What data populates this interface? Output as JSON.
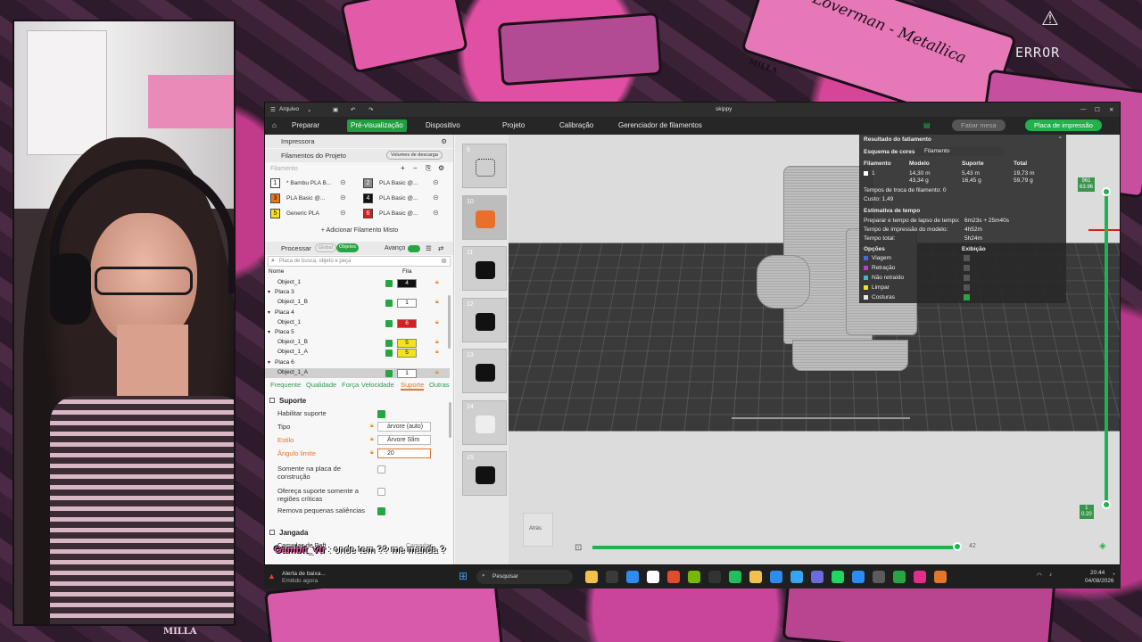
{
  "background": {
    "tape_labels": [
      "Loverman - Metallica",
      "MILLA",
      "MILLA"
    ],
    "error_text": "ERROR"
  },
  "window": {
    "title": "skippy",
    "menu_label": "Arquivo"
  },
  "navbar": {
    "items": [
      "Preparar",
      "Pré-visualização",
      "Dispositivo",
      "Projeto",
      "Calibração",
      "Gerenciador de filamentos"
    ],
    "active_index": 1,
    "fatiar_label": "Fatiar mesa",
    "print_label": "Placa de impressão"
  },
  "left_panel": {
    "printer_label": "Impressora",
    "filaments_label": "Filamentos do Projeto",
    "volumes_label": "Volumes de descarga",
    "filament_header": "Filamento",
    "filaments": [
      {
        "num": "1",
        "name": "* Bambu PLA B...",
        "color": "#ffffff",
        "text_color": "#111111"
      },
      {
        "num": "2",
        "name": "PLA Basic @...",
        "color": "#8a8a8a",
        "text_color": "#ffffff"
      },
      {
        "num": "3",
        "name": "PLA Basic @...",
        "color": "#e87722",
        "text_color": "#111111"
      },
      {
        "num": "4",
        "name": "PLA Basic @...",
        "color": "#111111",
        "text_color": "#ffffff"
      },
      {
        "num": "5",
        "name": "Generic PLA",
        "color": "#f5e21a",
        "text_color": "#111111"
      },
      {
        "num": "6",
        "name": "PLA Basic @...",
        "color": "#d42020",
        "text_color": "#ffffff"
      }
    ],
    "add_mixed": "+ Adicionar Filamento Misto",
    "process_label": "Processar",
    "global_label": "Global",
    "objects_label": "Objetos",
    "advanced_label": "Avanço",
    "search_placeholder": "Placa de busca, objeto e peça",
    "col_name": "Nome",
    "col_fil": "Fila",
    "objects": [
      {
        "label": "Object_1",
        "indent": 1,
        "fil": "4",
        "fil_color": "#111111",
        "fil_text": "#ffffff",
        "check": true
      },
      {
        "label": "Placa 3",
        "indent": 0,
        "fil": "",
        "check": false
      },
      {
        "label": "Object_1_B",
        "indent": 1,
        "fil": "1",
        "fil_color": "#ffffff",
        "fil_text": "#111111",
        "check": true
      },
      {
        "label": "Placa 4",
        "indent": 0,
        "fil": "",
        "check": false
      },
      {
        "label": "Object_1",
        "indent": 1,
        "fil": "6",
        "fil_color": "#d42020",
        "fil_text": "#ffffff",
        "check": true
      },
      {
        "label": "Placa 5",
        "indent": 0,
        "fil": "",
        "check": false
      },
      {
        "label": "Object_1_B",
        "indent": 1,
        "fil": "5",
        "fil_color": "#f5e21a",
        "fil_text": "#111111",
        "check": true
      },
      {
        "label": "Object_1_A",
        "indent": 1,
        "fil": "5",
        "fil_color": "#f5e21a",
        "fil_text": "#111111",
        "check": true
      },
      {
        "label": "Placa 6",
        "indent": 0,
        "fil": "",
        "check": false
      },
      {
        "label": "Object_1_A",
        "indent": 1,
        "fil": "1",
        "fil_color": "#ffffff",
        "fil_text": "#111111",
        "check": true,
        "selected": true
      }
    ],
    "tabs": [
      "Frequente",
      "Qualidade",
      "Força",
      "Velocidade",
      "Suporte",
      "Outras"
    ],
    "active_tab": 4,
    "support_title": "Suporte",
    "settings": [
      {
        "label": "Habilitar suporte",
        "type": "check",
        "on": true,
        "red": false
      },
      {
        "label": "Tipo",
        "type": "select",
        "value": "árvore (auto)",
        "red": false
      },
      {
        "label": "Estilo",
        "type": "select",
        "value": "Árvore Slim",
        "red": true
      },
      {
        "label": "Ângulo limite",
        "type": "input",
        "value": "20",
        "red": true
      },
      {
        "label": "Somente na placa de construção",
        "type": "check",
        "on": false,
        "red": false
      },
      {
        "label": "Ofereça suporte somente a regiões críticas",
        "type": "check",
        "on": false,
        "red": false
      },
      {
        "label": "Remova pequenas saliências",
        "type": "check",
        "on": true,
        "red": false
      }
    ],
    "raft_title": "Jangada",
    "raft_row": "Camadas de Raft",
    "raft_unit": "Camadas"
  },
  "thumbnails": [
    "9",
    "10",
    "11",
    "12",
    "13",
    "14",
    "15"
  ],
  "back_label": "Atrás",
  "results": {
    "title": "Resultado do fatiamento",
    "scheme_label": "Esquema de cores",
    "scheme_value": "Filamento",
    "columns": [
      "Filamento",
      "Modelo",
      "Suporte",
      "Total"
    ],
    "row": {
      "fil": "1",
      "modelo": "14,30 m\n43,34 g",
      "suporte": "5,43 m\n16,45 g",
      "total": "19,73 m\n59,79 g"
    },
    "swap_times": "Tempos de troca de filamento:  0",
    "cost": "Custo:  1,49",
    "time_title": "Estimativa de tempo",
    "prep_label": "Preparar e tempo de lapso de tempo:",
    "prep_value": "6m23s + 25m40s",
    "model_time_label": "Tempo de impressão do modelo:",
    "model_time_value": "4h52m",
    "total_label": "Tempo total:",
    "total_value": "5h24m",
    "options_label": "Opções",
    "display_label": "Exibição",
    "legend": [
      {
        "label": "Viagem",
        "color": "#3f6fd8",
        "on": false
      },
      {
        "label": "Retração",
        "color": "#c43ad1",
        "on": false
      },
      {
        "label": "Não retraído",
        "color": "#3fb6c9",
        "on": false
      },
      {
        "label": "Limpar",
        "color": "#f2e21b",
        "on": false
      },
      {
        "label": "Costuras",
        "color": "#e8e8e8",
        "on": true
      }
    ]
  },
  "vslider": {
    "top_a": "961",
    "top_b": "63.96",
    "bottom_a": "1",
    "bottom_b": "0.20"
  },
  "hslider": {
    "value": "42"
  },
  "chat": {
    "user": "Gambit_vtr",
    "message": ": onde tem ?? me manda ?"
  },
  "taskbar": {
    "notification_title": "Alerta de baixa...",
    "notification_sub": "Emitido agora",
    "search_label": "Pesquisar",
    "time": "20:44",
    "date": "04/08/2026"
  }
}
